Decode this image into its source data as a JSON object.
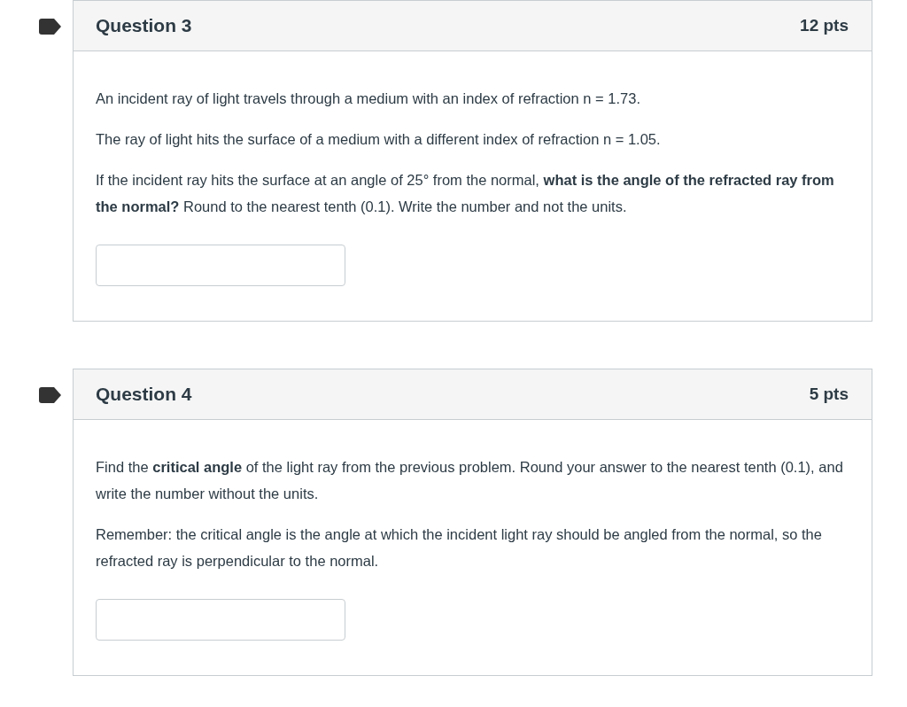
{
  "questions": [
    {
      "title": "Question 3",
      "points": "12 pts",
      "paragraphs": [
        "An incident ray of light travels through a medium with an index of refraction n = 1.73.",
        "The ray of light hits the surface of a medium with a different index of refraction n = 1.05.",
        "If the incident ray hits the surface at an angle of 25° from the normal, **what is the angle of the refracted ray from the normal?** Round to the nearest tenth (0.1). Write the number and not the units."
      ]
    },
    {
      "title": "Question 4",
      "points": "5 pts",
      "paragraphs": [
        "Find the **critical angle** of the light ray from the previous problem. Round your answer to the nearest tenth (0.1), and write the number without the units.",
        "Remember: the critical angle is the angle at which the incident light ray should be angled from the normal, so the refracted ray is perpendicular to the normal."
      ]
    }
  ]
}
